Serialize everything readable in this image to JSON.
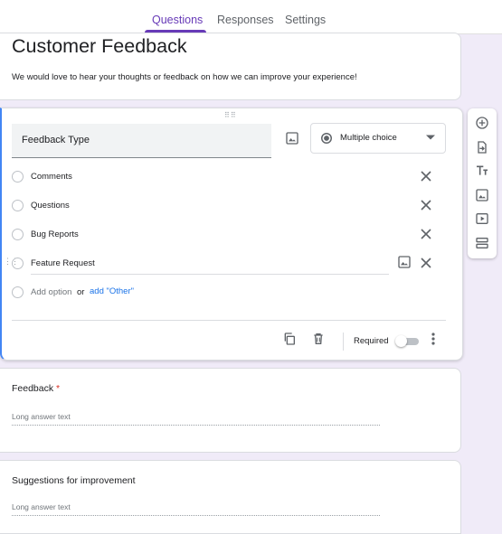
{
  "tabs": [
    {
      "label": "Questions",
      "active": true
    },
    {
      "label": "Responses",
      "active": false
    },
    {
      "label": "Settings",
      "active": false
    }
  ],
  "form": {
    "title": "Customer Feedback",
    "description": "We would love to hear your thoughts or feedback on how we can improve your experience!"
  },
  "question_editor": {
    "title": "Feedback Type",
    "type": "Multiple choice",
    "options": [
      "Comments",
      "Questions",
      "Bug Reports",
      "Feature Request"
    ],
    "add_option": "Add option",
    "or": "or",
    "add_other": "add \"Other\"",
    "required_label": "Required",
    "required": false
  },
  "questions": [
    {
      "title": "Feedback",
      "required_mark": "*",
      "placeholder": "Long answer text"
    },
    {
      "title": "Suggestions for improvement",
      "placeholder": "Long answer text"
    }
  ],
  "colors": {
    "accent": "#673ab7",
    "background": "#f0ebf8",
    "active_border": "#4285f4",
    "link": "#1a73e8",
    "required": "#d93025"
  },
  "icons": {
    "toolbar": [
      "add-question-icon",
      "import-questions-icon",
      "add-title-icon",
      "add-image-icon",
      "add-video-icon",
      "add-section-icon"
    ],
    "footer": [
      "duplicate-icon",
      "delete-icon",
      "more-vert-icon"
    ]
  }
}
